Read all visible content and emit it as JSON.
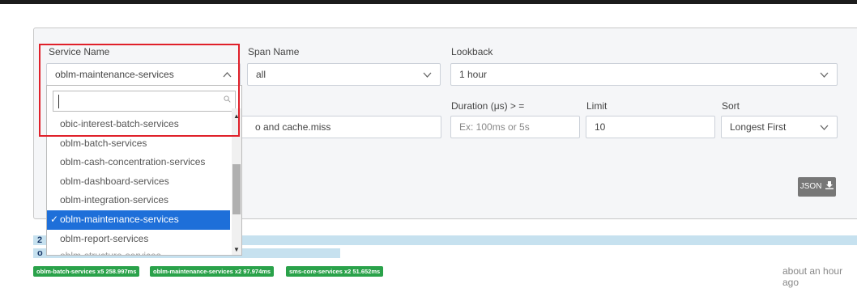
{
  "search_form": {
    "service_name": {
      "label": "Service Name",
      "value": "oblm-maintenance-services"
    },
    "span_name": {
      "label": "Span Name",
      "value": "all"
    },
    "lookback": {
      "label": "Lookback",
      "value": "1 hour"
    },
    "annotations_query": {
      "value": "o and cache.miss"
    },
    "duration": {
      "label": "Duration (μs) > =",
      "placeholder": "Ex: 100ms or 5s"
    },
    "limit": {
      "label": "Limit",
      "value": "10"
    },
    "sort": {
      "label": "Sort",
      "value": "Longest First"
    },
    "json_button": {
      "label": "JSON"
    }
  },
  "service_dropdown": {
    "search_value": "",
    "items": [
      {
        "label": "obic-interest-batch-services"
      },
      {
        "label": "oblm-batch-services"
      },
      {
        "label": "oblm-cash-concentration-services"
      },
      {
        "label": "oblm-dashboard-services"
      },
      {
        "label": "oblm-integration-services"
      },
      {
        "label": "oblm-maintenance-services",
        "selected": true
      },
      {
        "label": "oblm-report-services"
      },
      {
        "label": "oblm-structure-services"
      }
    ],
    "check_glyph": "✓"
  },
  "results": {
    "rows": [
      {
        "number": "2"
      },
      {
        "number": "o"
      }
    ],
    "tags": [
      "oblm-batch-services x5 258.997ms",
      "oblm-maintenance-services x2 97.974ms",
      "sms-core-services x2 51.652ms"
    ],
    "time_ago": "about an hour ago"
  }
}
